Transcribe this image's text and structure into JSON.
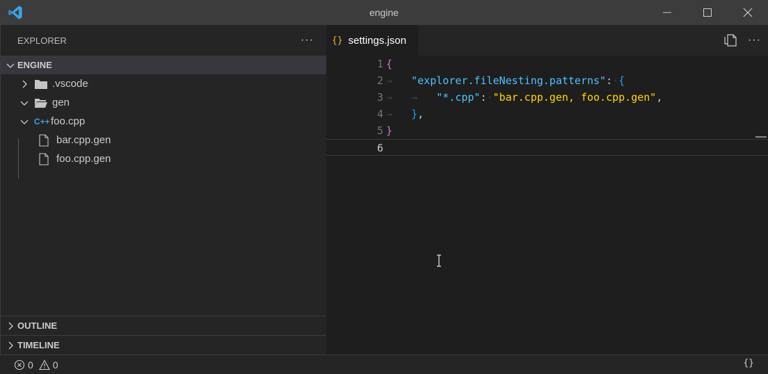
{
  "window": {
    "title": "engine"
  },
  "sidebar": {
    "header": "EXPLORER",
    "more_label": "···",
    "folder": "ENGINE",
    "items": [
      {
        "label": ".vscode",
        "icon": "folder-icon",
        "expanded": false
      },
      {
        "label": "gen",
        "icon": "folder-open-icon",
        "expanded": true
      },
      {
        "label": "foo.cpp",
        "icon": "cpp-file-icon",
        "icon_text": "C++",
        "expanded": true
      },
      {
        "label": "bar.cpp.gen",
        "icon": "file-icon"
      },
      {
        "label": "foo.cpp.gen",
        "icon": "file-icon"
      }
    ],
    "sections": [
      "OUTLINE",
      "TIMELINE"
    ]
  },
  "editor": {
    "tab": {
      "label": "settings.json",
      "icon_text": "{}"
    },
    "more_label": "···",
    "lines": [
      {
        "num": "1"
      },
      {
        "num": "2",
        "key": "\"explorer.fileNesting.patterns\""
      },
      {
        "num": "3",
        "key": "\"*.cpp\"",
        "value": "\"bar.cpp.gen, foo.cpp.gen\""
      },
      {
        "num": "4"
      },
      {
        "num": "5"
      },
      {
        "num": "6"
      }
    ]
  },
  "status": {
    "errors": "0",
    "warnings": "0",
    "language_icon": "{}"
  },
  "colors": {
    "titlebar": "#3c3c3c",
    "sidebar": "#252526",
    "editor": "#1e1e1e",
    "accent": "#0078d4"
  }
}
